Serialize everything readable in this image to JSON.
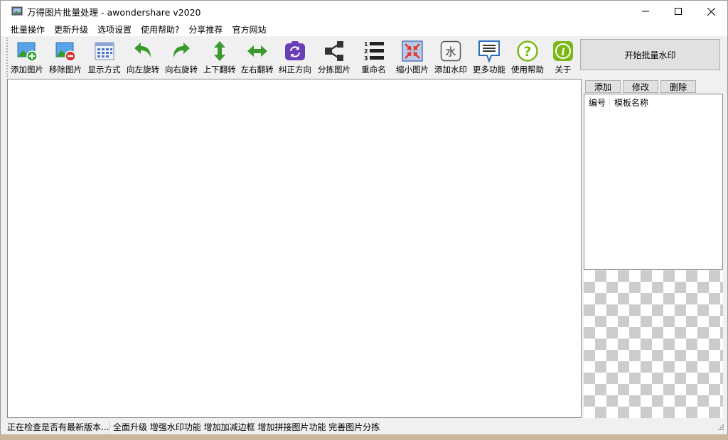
{
  "window": {
    "title": "万得图片批量处理 - awondershare v2020"
  },
  "menu": [
    {
      "label": "批量操作"
    },
    {
      "label": "更新升级"
    },
    {
      "label": "选项设置"
    },
    {
      "label": "使用帮助?"
    },
    {
      "label": "分享推荐"
    },
    {
      "label": "官方网站"
    }
  ],
  "toolbar": [
    {
      "label": "添加图片",
      "icon": "add-image-icon"
    },
    {
      "label": "移除图片",
      "icon": "remove-image-icon"
    },
    {
      "label": "显示方式",
      "icon": "view-mode-icon"
    },
    {
      "label": "向左旋转",
      "icon": "rotate-left-icon"
    },
    {
      "label": "向右旋转",
      "icon": "rotate-right-icon"
    },
    {
      "label": "上下翻转",
      "icon": "flip-vertical-icon"
    },
    {
      "label": "左右翻转",
      "icon": "flip-horizontal-icon"
    },
    {
      "label": "纠正方向",
      "icon": "correct-orientation-icon"
    },
    {
      "label": "分拣图片",
      "icon": "sort-images-icon"
    },
    {
      "label": "重命名",
      "icon": "rename-list-icon"
    },
    {
      "label": "缩小图片",
      "icon": "shrink-image-icon"
    },
    {
      "label": "添加水印",
      "icon": "watermark-icon"
    },
    {
      "label": "更多功能",
      "icon": "more-features-icon"
    },
    {
      "label": "使用帮助",
      "icon": "help-icon"
    },
    {
      "label": "关于",
      "icon": "info-icon"
    }
  ],
  "start_button": {
    "label": "开始批量水印"
  },
  "templates": {
    "add_label": "添加",
    "edit_label": "修改",
    "delete_label": "删除",
    "col_number": "编号",
    "col_name": "模板名称"
  },
  "status": {
    "left": "正在检查是否有最新版本.....",
    "right": "全面升级 增强水印功能 增加加减边框 增加拼接图片功能 完善图片分拣"
  },
  "colors": {
    "accent_green": "#3a9a2e",
    "accent_purple": "#6a3fb5",
    "accent_blue": "#2a6fb8",
    "help_green": "#7bb817"
  }
}
